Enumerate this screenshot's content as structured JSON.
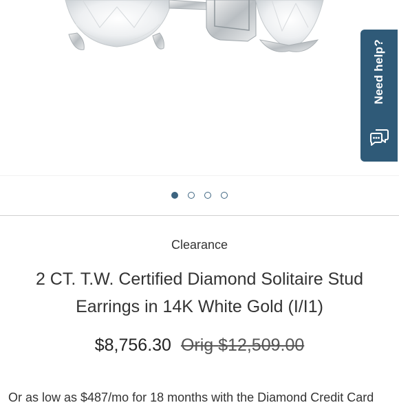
{
  "help": {
    "label": "Need help?",
    "icon": "chat-bubbles-icon"
  },
  "carousel": {
    "total": 4,
    "active": 0
  },
  "product": {
    "badge": "Clearance",
    "title": "2 CT. T.W. Certified Diamond Solitaire Stud Earrings in 14K White Gold (I/I1)",
    "price": "$8,756.30",
    "orig_label": "Orig",
    "orig_price": "$12,509.00"
  },
  "financing_text": "Or as low as $487/mo for 18 months with the Diamond Credit Card",
  "colors": {
    "accent": "#2f5a78",
    "dot": "#3d6480"
  }
}
